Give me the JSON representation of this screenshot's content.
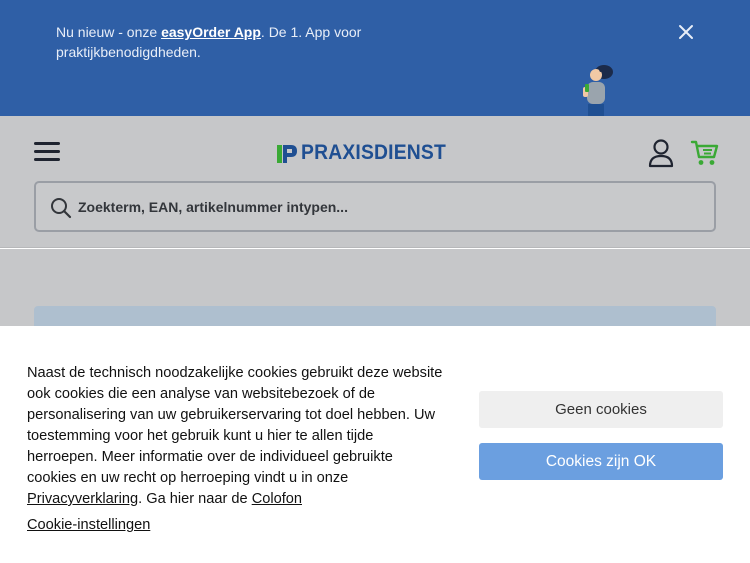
{
  "banner": {
    "text_before": "Nu nieuw - onze ",
    "app_name": "easyOrder App",
    "text_after": ". De 1. App voor praktijkbenodigdheden.",
    "close_label": "×"
  },
  "header": {
    "brand": "PRAXISDIENST",
    "search": {
      "placeholder": "Zoekterm, EAN, artikelnummer intypen..."
    }
  },
  "cookie": {
    "text_1": "Naast de technisch noodzakelijke cookies gebruikt deze website ook cookies die een analyse van websitebezoek of de personalisering van uw gebruikerservaring tot doel hebben. Uw toestemming voor het gebruik kunt u hier te allen tijde herroepen. Meer informatie over de individueel gebruikte cookies en uw recht op herroeping vindt u in onze ",
    "privacy_link": "Privacyverklaring",
    "text_2": ". Ga hier naar de ",
    "colofon_link": "Colofon",
    "settings_link": "Cookie-instellingen",
    "decline_label": "Geen cookies",
    "accept_label": "Cookies zijn OK"
  },
  "colors": {
    "banner_bg": "#2f5fa6",
    "brand_blue": "#1f4f92",
    "brand_green": "#3aa935",
    "accept_button": "#6b9fe0"
  },
  "icons": [
    "close-icon",
    "person-illustration-icon",
    "menu-icon",
    "logo-mark-icon",
    "account-icon",
    "cart-icon",
    "search-icon"
  ]
}
